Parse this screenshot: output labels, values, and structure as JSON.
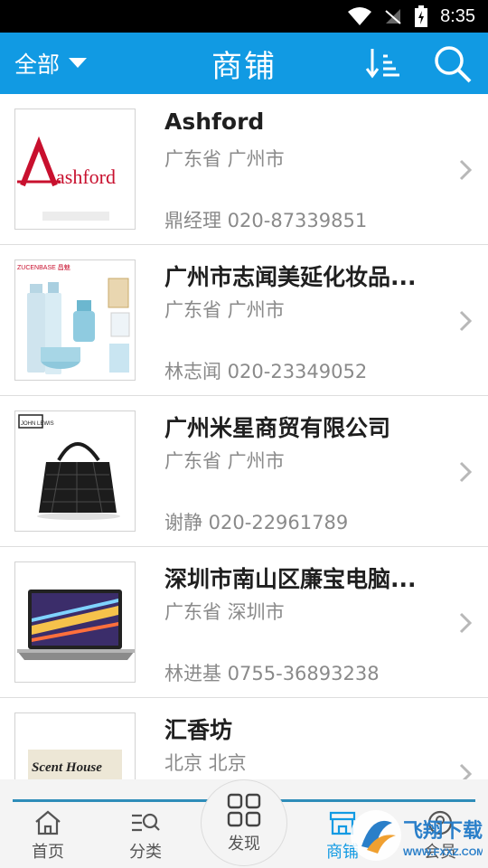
{
  "status_bar": {
    "time": "8:35"
  },
  "header": {
    "filter_label": "全部",
    "title": "商铺"
  },
  "stores": [
    {
      "name": "Ashford",
      "region": "广东省 广州市",
      "contact": "鼎经理 020-87339851",
      "thumb": "ashford-logo",
      "thumb_text": "ashford"
    },
    {
      "name": "广州市志闻美延化妆品...",
      "region": "广东省 广州市",
      "contact": "林志闻 020-23349052",
      "thumb": "cosmetics-bottles",
      "thumb_text": "ZUCENBASE 昌魅"
    },
    {
      "name": "广州米星商贸有限公司",
      "region": "广东省 广州市",
      "contact": "谢静 020-22961789",
      "thumb": "black-handbag",
      "thumb_text": "JOHN LEWIS"
    },
    {
      "name": "深圳市南山区廉宝电脑...",
      "region": "广东省 深圳市",
      "contact": "林进基 0755-36893238",
      "thumb": "laptop",
      "thumb_text": ""
    },
    {
      "name": "汇香坊",
      "region": "北京 北京",
      "contact": "",
      "thumb": "scent-house-logo",
      "thumb_text": "Scent House"
    }
  ],
  "tabs": [
    {
      "label": "首页",
      "icon": "home-icon"
    },
    {
      "label": "分类",
      "icon": "category-icon"
    },
    {
      "label": "发现",
      "icon": "grid-icon"
    },
    {
      "label": "商铺",
      "icon": "store-icon",
      "active": true
    },
    {
      "label": "会员",
      "icon": "member-icon"
    }
  ],
  "watermark": {
    "text": "飞翔下载",
    "url_text": "WWW.FXXZ.COM"
  },
  "colors": {
    "primary": "#119ae3",
    "tab_line": "#2e8db9",
    "logo_red": "#c8102e"
  }
}
